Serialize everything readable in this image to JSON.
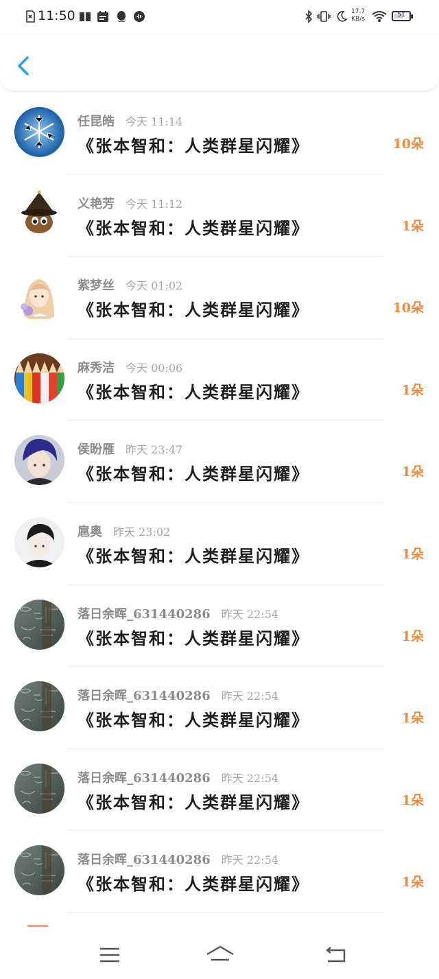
{
  "status_bar": {
    "time": "11:50",
    "net_speed_value": "17.7",
    "net_speed_unit": "KB/s",
    "battery": "51"
  },
  "header": {
    "back_icon": "chevron-left-icon",
    "accent_color": "#2aa0e6"
  },
  "accent_count_color": "#f08a3c",
  "list": [
    {
      "name": "任昆皓",
      "time": "今天 11:14",
      "title": "《张本智和：人类群星闪耀》",
      "count": "10朵",
      "avatar": "snowflake"
    },
    {
      "name": "义艳芳",
      "time": "今天 11:12",
      "title": "《张本智和：人类群星闪耀》",
      "count": "1朵",
      "avatar": "witch-cat"
    },
    {
      "name": "紫梦丝",
      "time": "今天 01:02",
      "title": "《张本智和：人类群星闪耀》",
      "count": "10朵",
      "avatar": "anime-girl"
    },
    {
      "name": "麻秀洁",
      "time": "今天 00:06",
      "title": "《张本智和：人类群星闪耀》",
      "count": "1朵",
      "avatar": "pencils"
    },
    {
      "name": "侯盼雁",
      "time": "昨天 23:47",
      "title": "《张本智和：人类群星闪耀》",
      "count": "1朵",
      "avatar": "boy-blue-hair"
    },
    {
      "name": "扈奥",
      "time": "昨天 23:02",
      "title": "《张本智和：人类群星闪耀》",
      "count": "1朵",
      "avatar": "boy-portrait"
    },
    {
      "name": "落日余晖_631440286",
      "time": "昨天 22:54",
      "title": "《张本智和：人类群星闪耀》",
      "count": "1朵",
      "avatar": "chalkboard"
    },
    {
      "name": "落日余晖_631440286",
      "time": "昨天 22:54",
      "title": "《张本智和：人类群星闪耀》",
      "count": "1朵",
      "avatar": "chalkboard"
    },
    {
      "name": "落日余晖_631440286",
      "time": "昨天 22:54",
      "title": "《张本智和：人类群星闪耀》",
      "count": "1朵",
      "avatar": "chalkboard"
    },
    {
      "name": "落日余晖_631440286",
      "time": "昨天 22:54",
      "title": "《张本智和：人类群星闪耀》",
      "count": "1朵",
      "avatar": "chalkboard"
    }
  ],
  "nav_bar": {
    "menu_icon": "menu-icon",
    "home_icon": "home-icon",
    "back_icon": "back-icon"
  }
}
